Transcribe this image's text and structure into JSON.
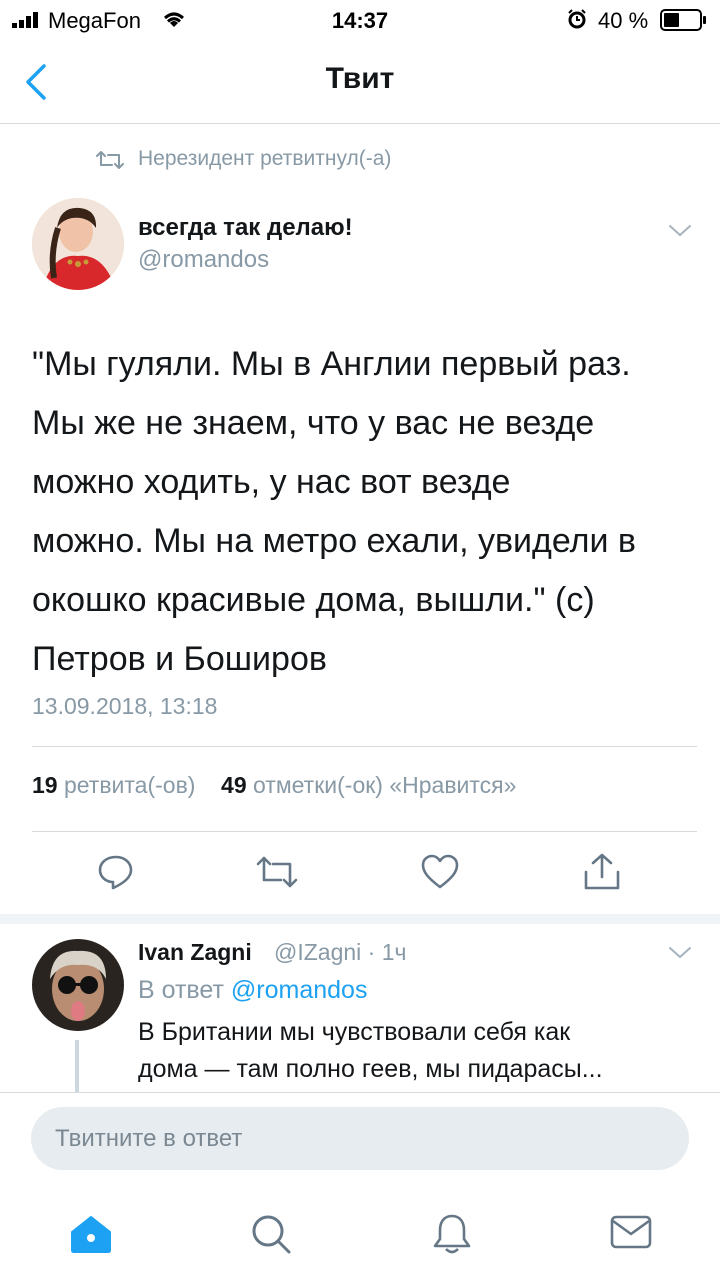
{
  "status_bar": {
    "carrier": "MegaFon",
    "time": "14:37",
    "battery": "40 %"
  },
  "nav": {
    "title": "Твит",
    "back_icon": "chevron-left-icon"
  },
  "retweet_header": {
    "text": "Нерезидент ретвитнул(-а)",
    "icon": "retweet-icon"
  },
  "tweet": {
    "display_name": "всегда так делаю!",
    "handle": "@romandos",
    "text_lines": [
      "\"Мы гуляли. Мы в Англии первый раз.",
      "Мы же не знаем, что у вас не везде",
      "можно ходить, у нас вот везде",
      "можно. Мы на метро ехали, увидели в",
      "окошко красивые дома, вышли.\" (с)",
      "Петров и Боширов"
    ],
    "timestamp": "13.09.2018, 13:18",
    "retweets_count": "19",
    "retweets_label": "ретвита(-ов)",
    "likes_count": "49",
    "likes_label": "отметки(-ок) «Нравится»"
  },
  "actions": {
    "reply_icon": "reply-icon",
    "retweet_icon": "retweet-icon",
    "like_icon": "heart-icon",
    "share_icon": "share-icon"
  },
  "reply": {
    "display_name": "Ivan Zagni",
    "handle_time": "@IZagni · 1ч",
    "in_reply_prefix": "В ответ",
    "in_reply_handle": "@romandos",
    "text_lines": [
      "В Британии мы чувствовали себя как",
      "дома — там полно геев, мы пидарасы..."
    ]
  },
  "compose": {
    "placeholder": "Твитните в ответ"
  },
  "tab_bar": {
    "home": "home-icon",
    "search": "search-icon",
    "notifications": "bell-icon",
    "messages": "mail-icon"
  },
  "colors": {
    "accent": "#1da1f2",
    "muted": "#8899a6",
    "text": "#14171a"
  }
}
